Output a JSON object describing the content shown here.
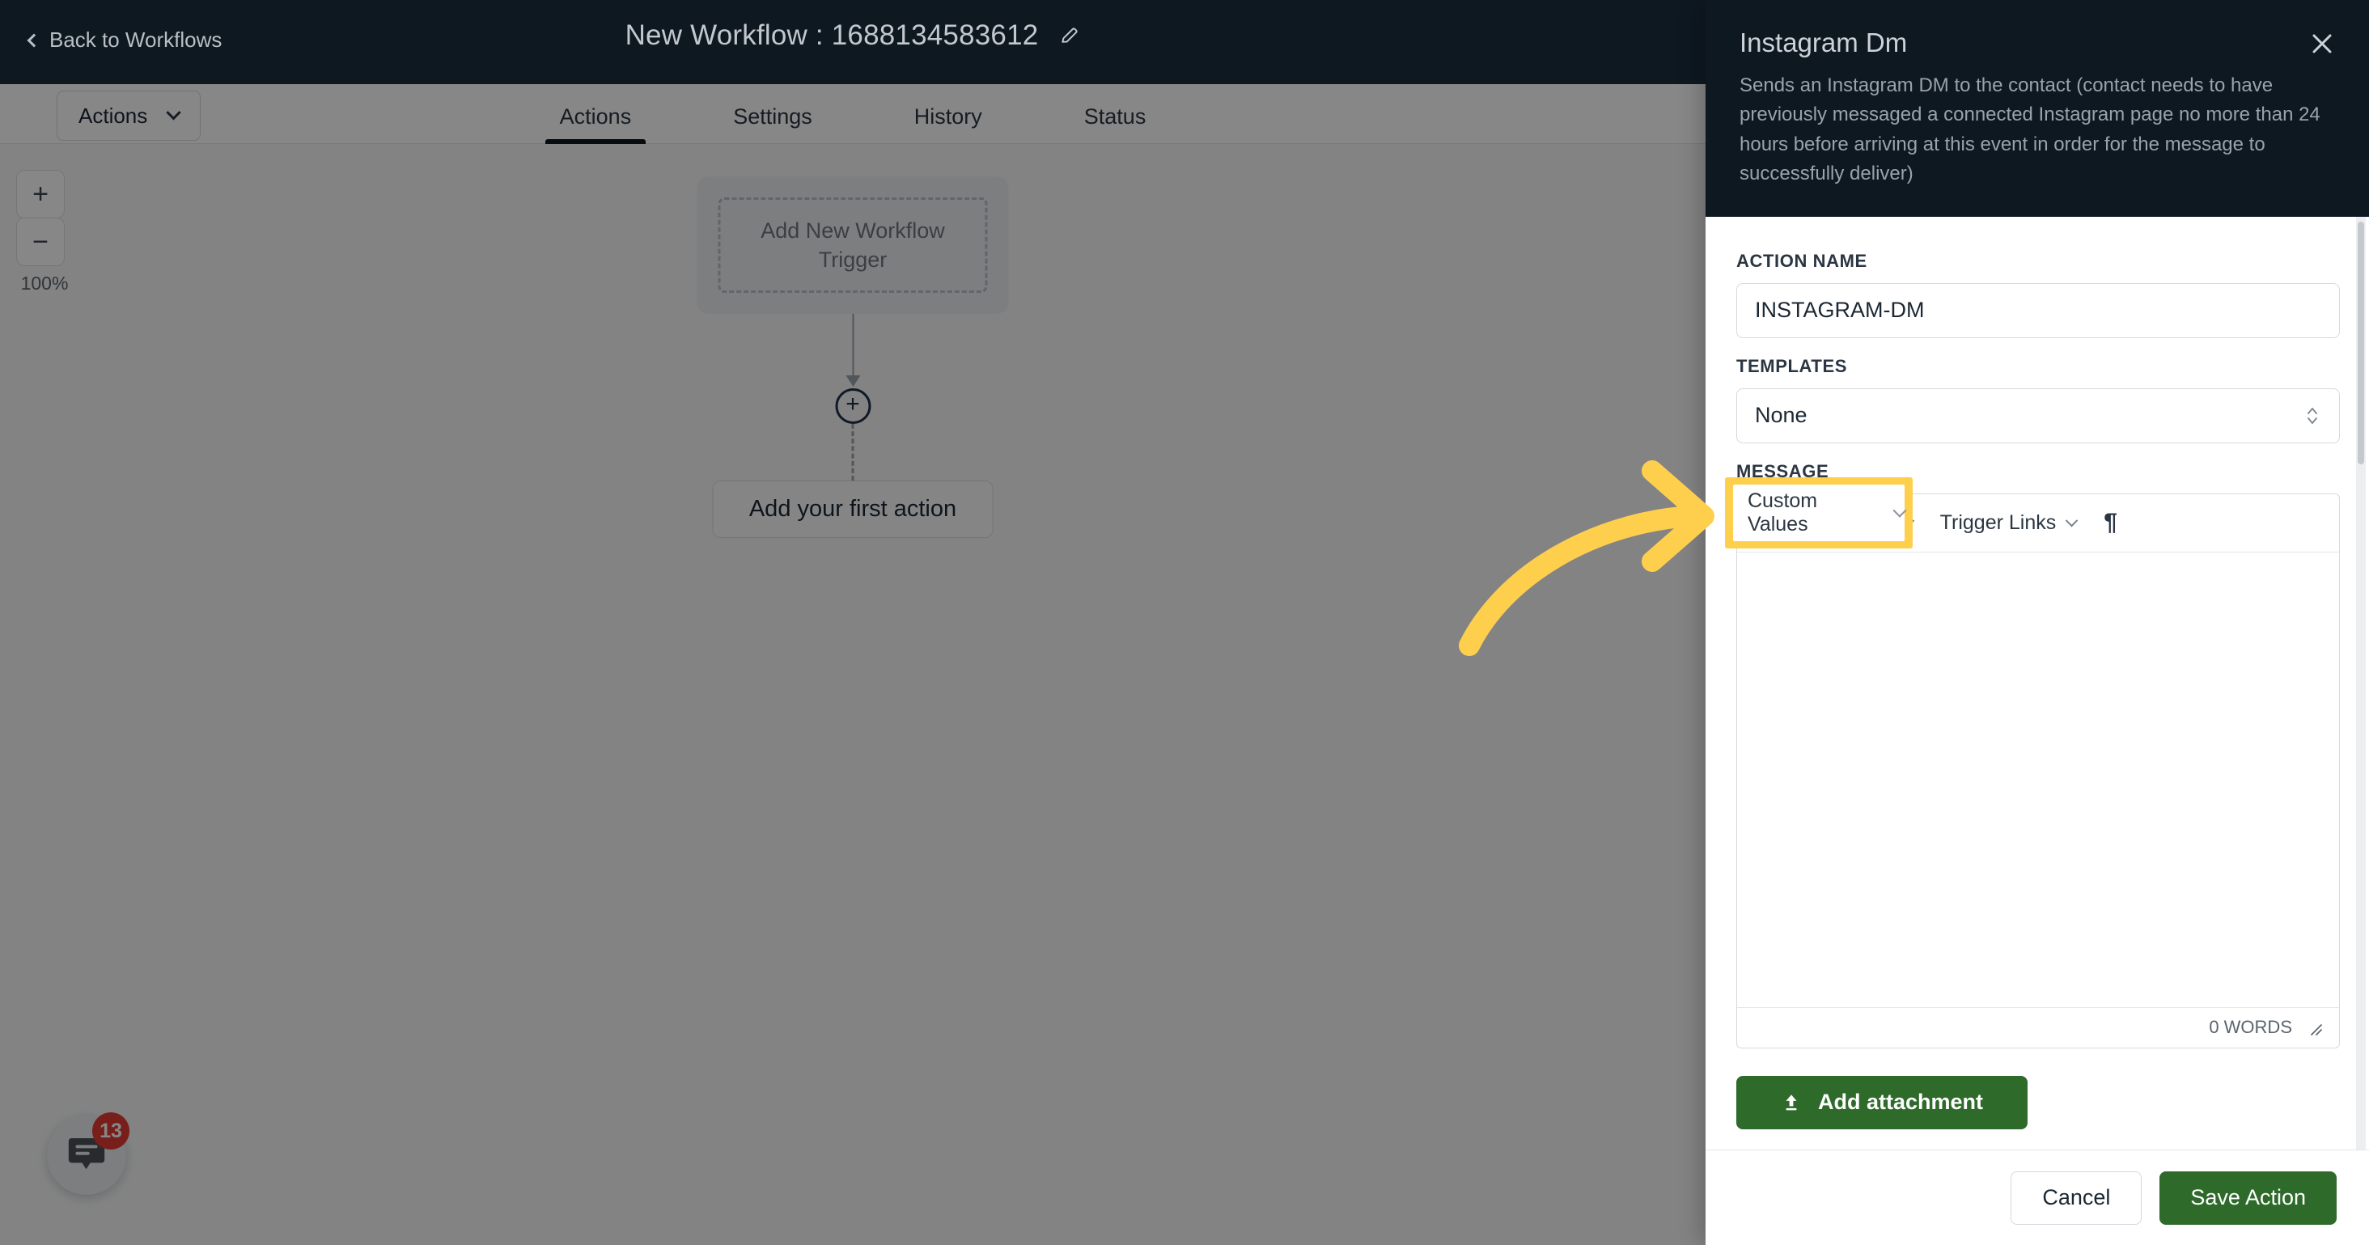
{
  "topbar": {
    "back_label": "Back to Workflows",
    "workflow_title": "New Workflow : 1688134583612",
    "edit_icon": "pencil-icon"
  },
  "subbar": {
    "actions_button": "Actions",
    "tabs": [
      {
        "label": "Actions",
        "active": true
      },
      {
        "label": "Settings",
        "active": false
      },
      {
        "label": "History",
        "active": false
      },
      {
        "label": "Status",
        "active": false
      }
    ]
  },
  "canvas": {
    "zoom": {
      "in": "+",
      "out": "−",
      "level": "100%"
    },
    "trigger_card_label": "Add New Workflow Trigger",
    "add_node_label": "+",
    "first_action_label": "Add your first action",
    "chat_widget": {
      "icon": "chat-bubble-icon",
      "badge": "13"
    }
  },
  "panel": {
    "title": "Instagram Dm",
    "description": "Sends an Instagram DM to the contact (contact needs to have previously messaged a connected Instagram page no more than 24 hours before arriving at this event in order for the message to successfully deliver)",
    "close_icon": "close-icon",
    "action_name": {
      "label": "ACTION NAME",
      "value": "INSTAGRAM-DM",
      "placeholder": "Action Name"
    },
    "templates": {
      "label": "TEMPLATES",
      "value": "None"
    },
    "message": {
      "label": "MESSAGE",
      "toolbar": {
        "custom_values": "Custom Values",
        "trigger_links": "Trigger Links",
        "paragraph_icon": "¶"
      },
      "body_value": "",
      "word_count": "0 WORDS"
    },
    "attachment_button": "Add attachment",
    "footer": {
      "cancel": "Cancel",
      "save": "Save Action"
    }
  },
  "annotation": {
    "highlight_target": "Custom Values",
    "highlight_color": "#fecf4d",
    "arrow_color": "#fecf4d"
  }
}
